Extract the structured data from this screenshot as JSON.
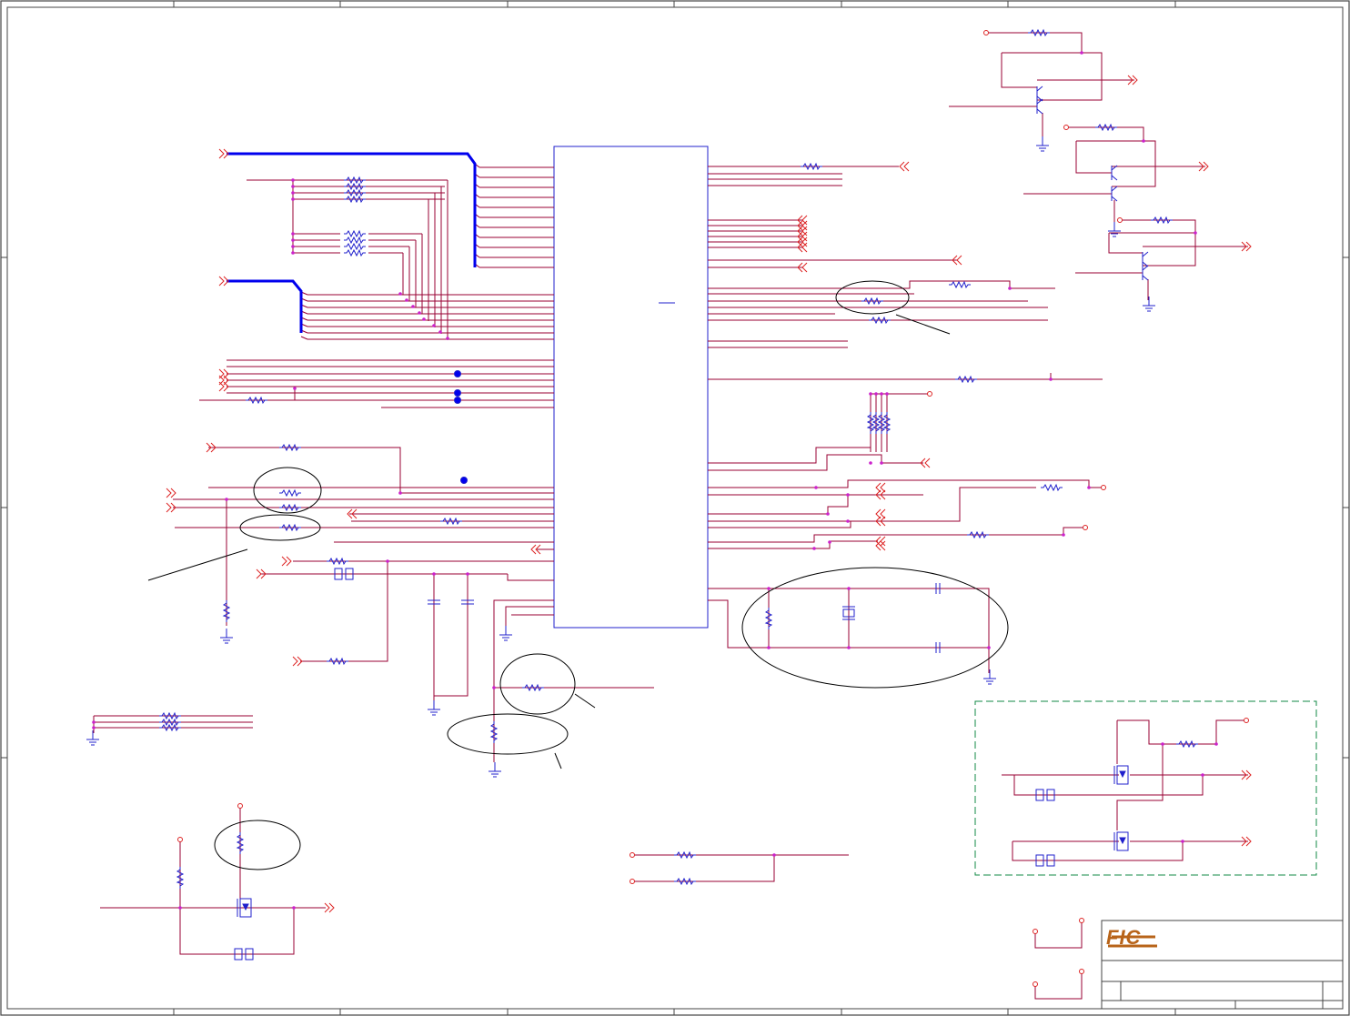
{
  "logo": {
    "text": "FIC",
    "color": "#b8641a"
  },
  "colors": {
    "wire": "#990033",
    "bus": "#0000ee",
    "component": "#2020cc",
    "port": "#dd2222",
    "junction": "#cc22cc",
    "frame": "#444444",
    "note_box": "#118844"
  }
}
